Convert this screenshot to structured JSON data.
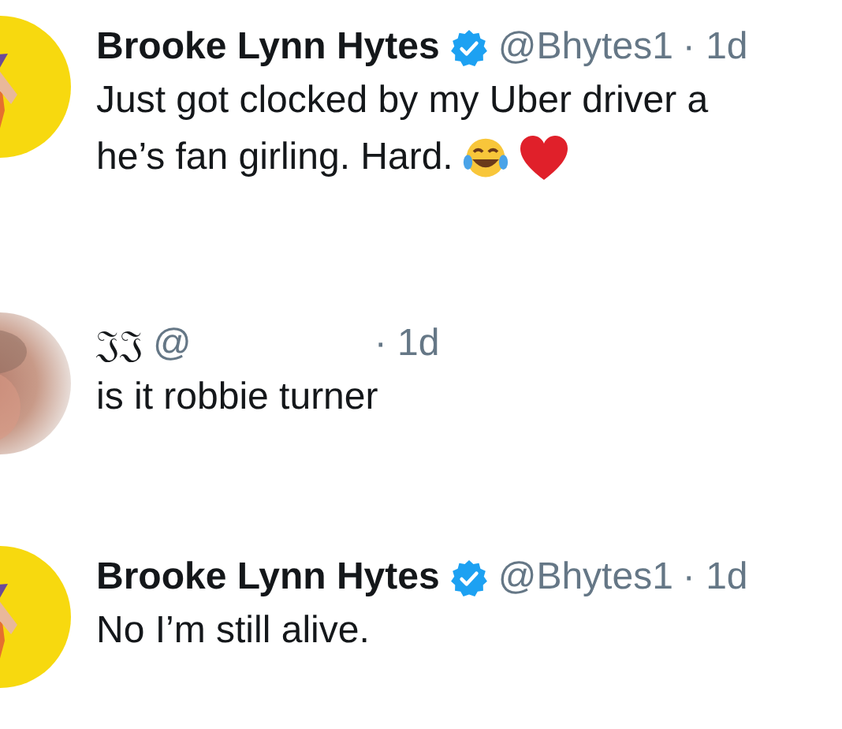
{
  "tweets": [
    {
      "avatar": {
        "kind": "figure"
      },
      "name": "Brooke Lynn Hytes",
      "verified": true,
      "handle": "@Bhytes1",
      "time": "· 1d",
      "text": [
        "Just got clocked by my Uber driver a",
        "he’s fan girling. Hard."
      ],
      "emoji": [
        {
          "kind": "tears_of_joy"
        },
        {
          "kind": "heart"
        }
      ]
    },
    {
      "avatar": {
        "kind": "blurred"
      },
      "name": "𝔍𝔍",
      "verified": false,
      "handle": "@",
      "time": "· 1d",
      "text": [
        "is it robbie turner"
      ]
    },
    {
      "avatar": {
        "kind": "figure"
      },
      "name": "Brooke Lynn Hytes",
      "verified": true,
      "handle": "@Bhytes1",
      "time": "· 1d",
      "text": [
        "No I’m still alive."
      ]
    }
  ]
}
